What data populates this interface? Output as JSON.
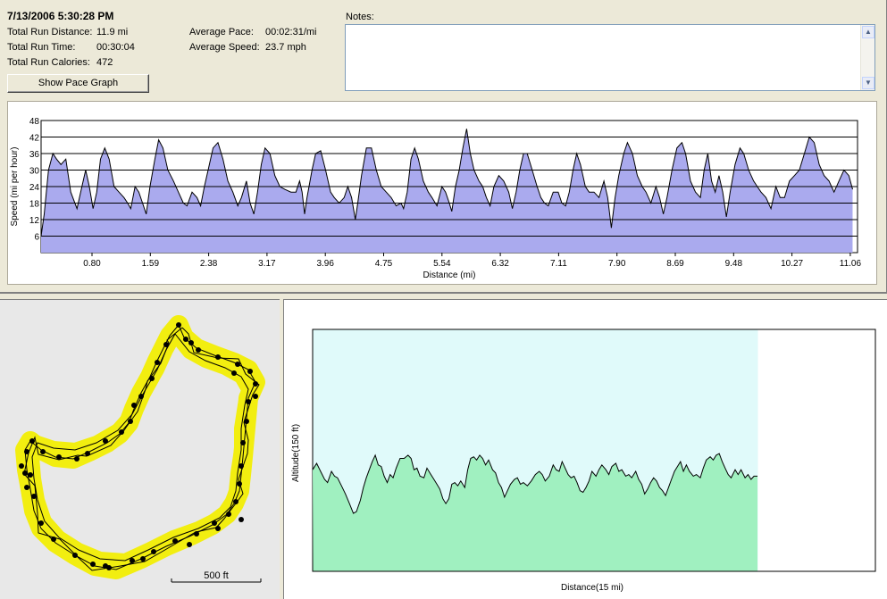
{
  "summary": {
    "timestamp": "7/13/2006   5:30:28 PM",
    "distance_label": "Total Run Distance:",
    "distance_value": "11.9 mi",
    "time_label": "Total Run Time:",
    "time_value": "00:30:04",
    "calories_label": "Total Run Calories:",
    "calories_value": "472",
    "pace_label": "Average Pace:",
    "pace_value": "00:02:31/mi",
    "speed_label": "Average Speed:",
    "speed_value": "23.7 mph"
  },
  "buttons": {
    "pace_graph": "Show Pace Graph"
  },
  "notes": {
    "label": "Notes:",
    "value": ""
  },
  "map": {
    "scale_label": "500 ft"
  },
  "chart_data": [
    {
      "type": "area",
      "ylabel": "Speed (mi per hour)",
      "xlabel": "Distance (mi)",
      "ylim": [
        0,
        48
      ],
      "yticks": [
        6,
        12,
        18,
        24,
        30,
        36,
        42,
        48
      ],
      "xticks": [
        "0.80",
        "1.59",
        "2.38",
        "3.17",
        "3.96",
        "4.75",
        "5.54",
        "6.32",
        "7.11",
        "7.90",
        "8.69",
        "9.48",
        "10.27",
        "11.06"
      ],
      "xtick_values": [
        0.8,
        1.59,
        2.38,
        3.17,
        3.96,
        4.75,
        5.54,
        6.32,
        7.11,
        7.9,
        8.69,
        9.48,
        10.27,
        11.06
      ],
      "xlim": [
        0,
        11.9
      ],
      "grid": true,
      "colors": {
        "fill": "#aaaaee",
        "line": "#000000"
      },
      "points": [
        [
          0.0,
          6
        ],
        [
          0.05,
          14
        ],
        [
          0.12,
          30
        ],
        [
          0.19,
          36
        ],
        [
          0.25,
          34
        ],
        [
          0.32,
          32
        ],
        [
          0.4,
          34
        ],
        [
          0.48,
          22
        ],
        [
          0.58,
          16
        ],
        [
          0.66,
          24
        ],
        [
          0.72,
          30
        ],
        [
          0.78,
          24
        ],
        [
          0.84,
          16
        ],
        [
          0.9,
          22
        ],
        [
          0.96,
          34
        ],
        [
          1.03,
          38
        ],
        [
          1.1,
          34
        ],
        [
          1.18,
          24
        ],
        [
          1.26,
          22
        ],
        [
          1.34,
          20
        ],
        [
          1.4,
          18
        ],
        [
          1.45,
          16
        ],
        [
          1.52,
          24
        ],
        [
          1.58,
          22
        ],
        [
          1.64,
          18
        ],
        [
          1.7,
          14
        ],
        [
          1.76,
          24
        ],
        [
          1.84,
          34
        ],
        [
          1.9,
          41
        ],
        [
          1.97,
          38
        ],
        [
          2.05,
          30
        ],
        [
          2.14,
          26
        ],
        [
          2.22,
          22
        ],
        [
          2.3,
          18
        ],
        [
          2.36,
          17
        ],
        [
          2.44,
          22
        ],
        [
          2.52,
          20
        ],
        [
          2.58,
          17
        ],
        [
          2.64,
          24
        ],
        [
          2.7,
          30
        ],
        [
          2.78,
          38
        ],
        [
          2.86,
          40
        ],
        [
          2.94,
          34
        ],
        [
          3.02,
          26
        ],
        [
          3.1,
          22
        ],
        [
          3.18,
          17
        ],
        [
          3.24,
          20
        ],
        [
          3.32,
          26
        ],
        [
          3.38,
          18
        ],
        [
          3.44,
          14
        ],
        [
          3.5,
          22
        ],
        [
          3.56,
          32
        ],
        [
          3.62,
          38
        ],
        [
          3.7,
          36
        ],
        [
          3.78,
          28
        ],
        [
          3.86,
          24
        ],
        [
          3.94,
          23
        ],
        [
          4.04,
          22
        ],
        [
          4.12,
          22
        ],
        [
          4.18,
          26
        ],
        [
          4.22,
          22
        ],
        [
          4.26,
          14
        ],
        [
          4.3,
          20
        ],
        [
          4.38,
          30
        ],
        [
          4.44,
          36
        ],
        [
          4.52,
          37
        ],
        [
          4.6,
          30
        ],
        [
          4.68,
          22
        ],
        [
          4.74,
          20
        ],
        [
          4.82,
          18
        ],
        [
          4.9,
          20
        ],
        [
          4.96,
          24
        ],
        [
          5.02,
          20
        ],
        [
          5.08,
          12
        ],
        [
          5.12,
          18
        ],
        [
          5.18,
          28
        ],
        [
          5.26,
          38
        ],
        [
          5.34,
          38
        ],
        [
          5.42,
          30
        ],
        [
          5.5,
          24
        ],
        [
          5.58,
          22
        ],
        [
          5.66,
          20
        ],
        [
          5.74,
          17
        ],
        [
          5.82,
          18
        ],
        [
          5.86,
          16
        ],
        [
          5.92,
          22
        ],
        [
          5.98,
          34
        ],
        [
          6.04,
          38
        ],
        [
          6.1,
          34
        ],
        [
          6.18,
          26
        ],
        [
          6.26,
          22
        ],
        [
          6.32,
          20
        ],
        [
          6.4,
          17
        ],
        [
          6.48,
          24
        ],
        [
          6.54,
          22
        ],
        [
          6.6,
          18
        ],
        [
          6.64,
          15
        ],
        [
          6.7,
          24
        ],
        [
          6.76,
          30
        ],
        [
          6.82,
          38
        ],
        [
          6.88,
          45
        ],
        [
          6.94,
          36
        ],
        [
          7.0,
          30
        ],
        [
          7.08,
          26
        ],
        [
          7.14,
          24
        ],
        [
          7.2,
          20
        ],
        [
          7.26,
          17
        ],
        [
          7.32,
          24
        ],
        [
          7.4,
          28
        ],
        [
          7.48,
          26
        ],
        [
          7.56,
          22
        ],
        [
          7.62,
          16
        ],
        [
          7.68,
          22
        ],
        [
          7.74,
          30
        ],
        [
          7.8,
          36
        ],
        [
          7.86,
          36
        ],
        [
          7.94,
          30
        ],
        [
          8.02,
          24
        ],
        [
          8.08,
          20
        ],
        [
          8.14,
          18
        ],
        [
          8.2,
          17
        ],
        [
          8.28,
          22
        ],
        [
          8.36,
          22
        ],
        [
          8.42,
          18
        ],
        [
          8.48,
          17
        ],
        [
          8.54,
          22
        ],
        [
          8.6,
          30
        ],
        [
          8.66,
          36
        ],
        [
          8.72,
          32
        ],
        [
          8.8,
          24
        ],
        [
          8.86,
          22
        ],
        [
          8.94,
          22
        ],
        [
          9.02,
          20
        ],
        [
          9.1,
          26
        ],
        [
          9.16,
          20
        ],
        [
          9.22,
          9
        ],
        [
          9.28,
          20
        ],
        [
          9.34,
          28
        ],
        [
          9.42,
          36
        ],
        [
          9.48,
          40
        ],
        [
          9.56,
          36
        ],
        [
          9.64,
          28
        ],
        [
          9.72,
          24
        ],
        [
          9.78,
          22
        ],
        [
          9.86,
          18
        ],
        [
          9.94,
          24
        ],
        [
          10.0,
          20
        ],
        [
          10.06,
          14
        ],
        [
          10.12,
          20
        ],
        [
          10.2,
          30
        ],
        [
          10.28,
          38
        ],
        [
          10.36,
          40
        ],
        [
          10.42,
          36
        ],
        [
          10.5,
          26
        ],
        [
          10.58,
          22
        ],
        [
          10.66,
          20
        ],
        [
          10.72,
          30
        ],
        [
          10.78,
          36
        ],
        [
          10.84,
          26
        ],
        [
          10.9,
          22
        ],
        [
          10.96,
          28
        ],
        [
          11.02,
          22
        ],
        [
          11.08,
          13
        ],
        [
          11.14,
          22
        ],
        [
          11.22,
          32
        ],
        [
          11.3,
          38
        ],
        [
          11.36,
          36
        ],
        [
          11.44,
          30
        ],
        [
          11.52,
          26
        ],
        [
          11.58,
          24
        ],
        [
          11.64,
          22
        ],
        [
          11.72,
          20
        ],
        [
          11.8,
          16
        ],
        [
          11.88,
          24
        ],
        [
          11.95,
          20
        ],
        [
          12.02,
          20
        ],
        [
          12.1,
          26
        ],
        [
          12.18,
          28
        ],
        [
          12.26,
          30
        ],
        [
          12.34,
          36
        ],
        [
          12.42,
          42
        ],
        [
          12.5,
          40
        ],
        [
          12.58,
          32
        ],
        [
          12.66,
          28
        ],
        [
          12.74,
          26
        ],
        [
          12.82,
          22
        ],
        [
          12.9,
          26
        ],
        [
          12.98,
          30
        ],
        [
          13.06,
          28
        ],
        [
          13.12,
          23
        ]
      ]
    },
    {
      "type": "area",
      "ylabel": "Altitude(150 ft)",
      "xlabel": "Distance(15 mi)",
      "xlim": [
        0,
        15
      ],
      "ylim": [
        0,
        150
      ],
      "colors": {
        "fill": "#a0f0c0",
        "line": "#000000",
        "sky": "#e0fafa"
      },
      "points": [
        [
          0.0,
          63
        ],
        [
          0.08,
          67
        ],
        [
          0.16,
          62
        ],
        [
          0.24,
          57
        ],
        [
          0.3,
          55
        ],
        [
          0.38,
          62
        ],
        [
          0.44,
          59
        ],
        [
          0.5,
          58
        ],
        [
          0.58,
          53
        ],
        [
          0.66,
          48
        ],
        [
          0.74,
          42
        ],
        [
          0.82,
          36
        ],
        [
          0.88,
          37
        ],
        [
          0.96,
          44
        ],
        [
          1.02,
          52
        ],
        [
          1.08,
          58
        ],
        [
          1.14,
          63
        ],
        [
          1.2,
          68
        ],
        [
          1.26,
          72
        ],
        [
          1.32,
          66
        ],
        [
          1.38,
          65
        ],
        [
          1.44,
          59
        ],
        [
          1.5,
          55
        ],
        [
          1.56,
          60
        ],
        [
          1.62,
          58
        ],
        [
          1.68,
          64
        ],
        [
          1.76,
          70
        ],
        [
          1.84,
          70
        ],
        [
          1.92,
          72
        ],
        [
          1.98,
          70
        ],
        [
          2.04,
          63
        ],
        [
          2.1,
          64
        ],
        [
          2.16,
          59
        ],
        [
          2.24,
          58
        ],
        [
          2.3,
          64
        ],
        [
          2.38,
          60
        ],
        [
          2.44,
          57
        ],
        [
          2.5,
          54
        ],
        [
          2.56,
          51
        ],
        [
          2.62,
          45
        ],
        [
          2.68,
          42
        ],
        [
          2.74,
          45
        ],
        [
          2.8,
          54
        ],
        [
          2.86,
          55
        ],
        [
          2.92,
          53
        ],
        [
          2.98,
          56
        ],
        [
          3.06,
          52
        ],
        [
          3.12,
          63
        ],
        [
          3.18,
          70
        ],
        [
          3.24,
          71
        ],
        [
          3.3,
          69
        ],
        [
          3.36,
          72
        ],
        [
          3.42,
          70
        ],
        [
          3.48,
          66
        ],
        [
          3.54,
          69
        ],
        [
          3.62,
          63
        ],
        [
          3.68,
          61
        ],
        [
          3.74,
          55
        ],
        [
          3.8,
          52
        ],
        [
          3.86,
          46
        ],
        [
          3.92,
          50
        ],
        [
          3.98,
          54
        ],
        [
          4.06,
          57
        ],
        [
          4.12,
          58
        ],
        [
          4.18,
          54
        ],
        [
          4.24,
          55
        ],
        [
          4.32,
          53
        ],
        [
          4.4,
          56
        ],
        [
          4.48,
          60
        ],
        [
          4.56,
          62
        ],
        [
          4.62,
          60
        ],
        [
          4.68,
          56
        ],
        [
          4.76,
          59
        ],
        [
          4.84,
          66
        ],
        [
          4.9,
          63
        ],
        [
          4.96,
          62
        ],
        [
          5.02,
          68
        ],
        [
          5.08,
          64
        ],
        [
          5.14,
          60
        ],
        [
          5.2,
          58
        ],
        [
          5.26,
          59
        ],
        [
          5.32,
          55
        ],
        [
          5.38,
          50
        ],
        [
          5.44,
          49
        ],
        [
          5.5,
          52
        ],
        [
          5.56,
          56
        ],
        [
          5.62,
          62
        ],
        [
          5.7,
          59
        ],
        [
          5.76,
          63
        ],
        [
          5.82,
          66
        ],
        [
          5.9,
          63
        ],
        [
          5.96,
          60
        ],
        [
          6.02,
          65
        ],
        [
          6.1,
          67
        ],
        [
          6.16,
          62
        ],
        [
          6.22,
          63
        ],
        [
          6.3,
          59
        ],
        [
          6.36,
          60
        ],
        [
          6.42,
          58
        ],
        [
          6.5,
          62
        ],
        [
          6.56,
          57
        ],
        [
          6.62,
          54
        ],
        [
          6.68,
          48
        ],
        [
          6.74,
          51
        ],
        [
          6.8,
          55
        ],
        [
          6.86,
          58
        ],
        [
          6.92,
          56
        ],
        [
          6.98,
          52
        ],
        [
          7.04,
          50
        ],
        [
          7.1,
          47
        ],
        [
          7.16,
          52
        ],
        [
          7.22,
          57
        ],
        [
          7.28,
          62
        ],
        [
          7.34,
          65
        ],
        [
          7.4,
          68
        ],
        [
          7.46,
          62
        ],
        [
          7.52,
          66
        ],
        [
          7.58,
          62
        ],
        [
          7.66,
          59
        ],
        [
          7.72,
          60
        ],
        [
          7.8,
          58
        ],
        [
          7.86,
          64
        ],
        [
          7.92,
          69
        ],
        [
          8.0,
          71
        ],
        [
          8.06,
          69
        ],
        [
          8.12,
          72
        ],
        [
          8.18,
          73
        ],
        [
          8.24,
          68
        ],
        [
          8.3,
          64
        ],
        [
          8.36,
          60
        ],
        [
          8.42,
          58
        ],
        [
          8.5,
          63
        ],
        [
          8.56,
          60
        ],
        [
          8.62,
          63
        ],
        [
          8.7,
          58
        ],
        [
          8.76,
          60
        ],
        [
          8.82,
          57
        ],
        [
          8.88,
          59
        ],
        [
          8.95,
          59
        ]
      ]
    }
  ]
}
